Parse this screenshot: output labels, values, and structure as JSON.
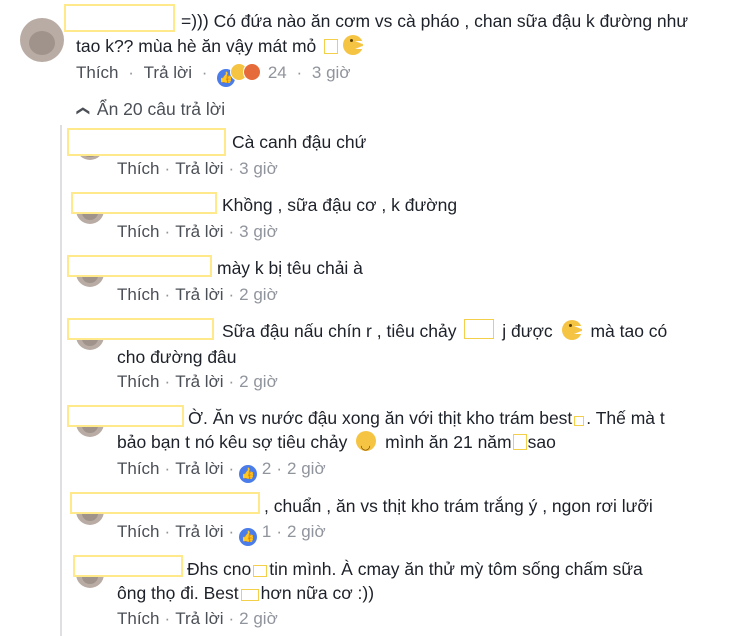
{
  "main_comment": {
    "text_line1": "=))) Có đứa nào ăn cơm vs cà pháo , chan sữa đậu k đường như",
    "text_line2": "tao k?? mùa hè ăn vậy mát mỏ",
    "like": "Thích",
    "reply": "Trả lời",
    "reaction_count": "24",
    "time": "3 giờ"
  },
  "collapse": {
    "icon": "chevron-up-icon",
    "label": "Ẩn 20 câu trả lời"
  },
  "replies": [
    {
      "text_lines": [
        "Cà canh đậu chứ"
      ],
      "like": "Thích",
      "reply": "Trả lời",
      "time": "3 giờ"
    },
    {
      "text_lines": [
        "Khồng , sữa đậu cơ , k đường"
      ],
      "like": "Thích",
      "reply": "Trả lời",
      "time": "3 giờ"
    },
    {
      "text_lines": [
        "mày k bị têu chải à"
      ],
      "like": "Thích",
      "reply": "Trả lời",
      "time": "2 giờ"
    },
    {
      "text_lines": [
        "Sữa đậu nấu chín r , tiêu chảy",
        "j được",
        "mà tao có",
        "cho đường đâu"
      ],
      "like": "Thích",
      "reply": "Trả lời",
      "time": "2 giờ"
    },
    {
      "text_lines": [
        "Ờ. Ăn vs nước đậu xong ăn với thịt kho trám best",
        ". Thế mà t",
        "bảo bạn t nó kêu sợ tiêu chảy",
        "mình ăn 21 năm",
        "sao"
      ],
      "like": "Thích",
      "reply": "Trả lời",
      "reaction_count": "2",
      "time": "2 giờ"
    },
    {
      "text_lines": [
        ", chuẩn , ăn vs thịt kho trám trắng ý , ngon rơi lưỡi"
      ],
      "like": "Thích",
      "reply": "Trả lời",
      "reaction_count": "1",
      "time": "2 giờ"
    },
    {
      "text_lines": [
        "Đhs cno",
        "tin mình. À cmay ăn thử mỳ tôm sống chấm sữa",
        "ông thọ đi. Best",
        "hơn nữa cơ :))"
      ],
      "like": "Thích",
      "reply": "Trả lời",
      "time": "2 giờ"
    }
  ],
  "colors": {
    "text": "#1d2129",
    "meta": "#90949c",
    "like_blue": "#4a7dea",
    "redaction_border": "#ffe98a"
  }
}
